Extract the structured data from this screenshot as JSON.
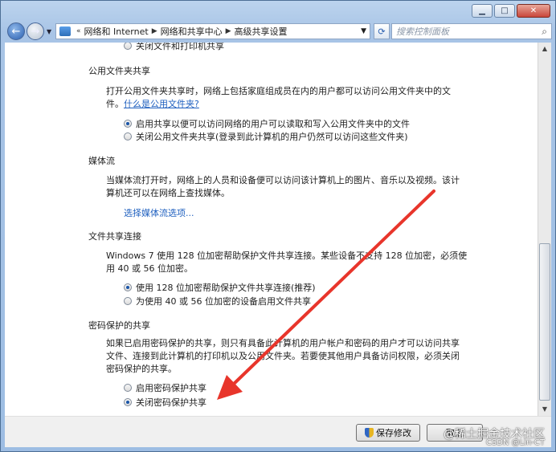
{
  "window": {
    "min_glyph": "▁",
    "max_glyph": "□",
    "close_glyph": "✕"
  },
  "nav": {
    "breadcrumbs": [
      "网络和 Internet",
      "网络和共享中心",
      "高级共享设置"
    ],
    "search_placeholder": "搜索控制面板"
  },
  "top_cut_option": "关闭文件和打印机共享",
  "sections": {
    "public_folder": {
      "title": "公用文件夹共享",
      "desc": "打开公用文件夹共享时，网络上包括家庭组成员在内的用户都可以访问公用文件夹中的文件。",
      "desc_link": "什么是公用文件夹?",
      "options": [
        "启用共享以便可以访问网络的用户可以读取和写入公用文件夹中的文件",
        "关闭公用文件夹共享(登录到此计算机的用户仍然可以访问这些文件夹)"
      ],
      "selected": 0
    },
    "media": {
      "title": "媒体流",
      "desc": "当媒体流打开时，网络上的人员和设备便可以访问该计算机上的图片、音乐以及视频。该计算机还可以在网络上查找媒体。",
      "link": "选择媒体流选项..."
    },
    "file_sharing": {
      "title": "文件共享连接",
      "desc": "Windows 7 使用 128 位加密帮助保护文件共享连接。某些设备不支持 128 位加密，必须使用 40 或 56 位加密。",
      "options": [
        "使用 128 位加密帮助保护文件共享连接(推荐)",
        "为使用 40 或 56 位加密的设备启用文件共享"
      ],
      "selected": 0
    },
    "password": {
      "title": "密码保护的共享",
      "desc": "如果已启用密码保护的共享，则只有具备此计算机的用户帐户和密码的用户才可以访问共享文件、连接到此计算机的打印机以及公用文件夹。若要使其他用户具备访问权限，必须关闭密码保护的共享。",
      "options": [
        "启用密码保护共享",
        "关闭密码保护共享"
      ],
      "selected": 1
    }
  },
  "buttons": {
    "save": "保存修改",
    "cancel": "取消"
  },
  "watermark": {
    "line1": "@稀土掘金技术社区",
    "line2": "CSDN @Lin-CT"
  },
  "colors": {
    "annotation_arrow": "#e8352b",
    "link": "#1e5fbf"
  }
}
